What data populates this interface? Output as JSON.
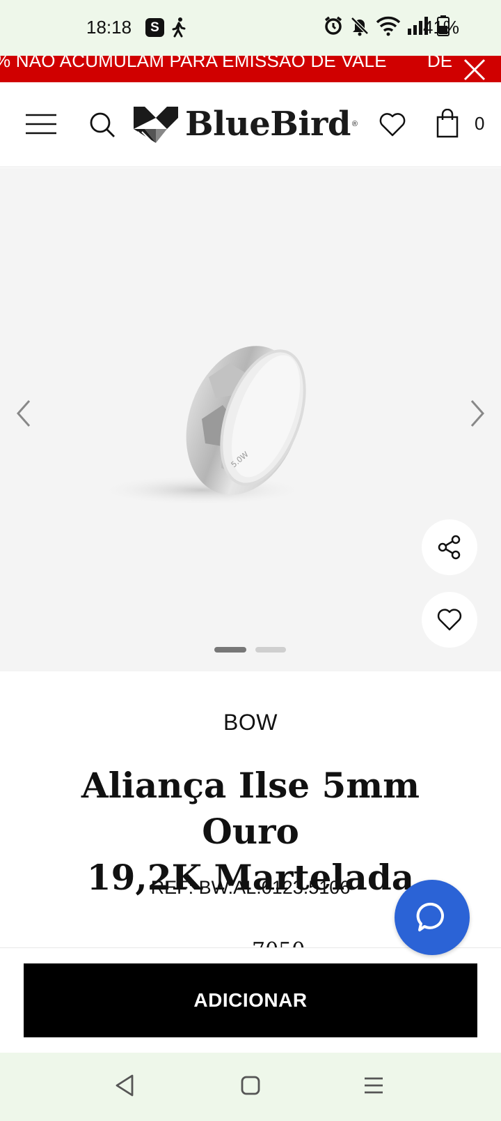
{
  "status_bar": {
    "time": "18:18",
    "app_badge": "S",
    "battery": "41%",
    "icons": [
      "walk-icon",
      "alarm-icon",
      "bell-off-icon",
      "wifi-icon",
      "signal-icon",
      "battery-icon"
    ]
  },
  "promo": {
    "text": "% NÃO ACUMULAM PARA EMISSÃO DE VALE",
    "text_tail": "DE",
    "color": "#d00000"
  },
  "header": {
    "logo_text": "BlueBird",
    "logo_mark": "®",
    "cart_count": "0"
  },
  "gallery": {
    "slides": 2,
    "active_slide": 1,
    "ring_engraving": "5.0W"
  },
  "product": {
    "brand": "BOW",
    "title_line1": "Aliança Ilse 5mm Ouro",
    "title_line2": "19,2K Martelada",
    "ref": "REF: BW.AL.0123.5106",
    "price_peek": "7050"
  },
  "actions": {
    "add_label": "ADICIONAR",
    "chat_color": "#2b63d6"
  }
}
